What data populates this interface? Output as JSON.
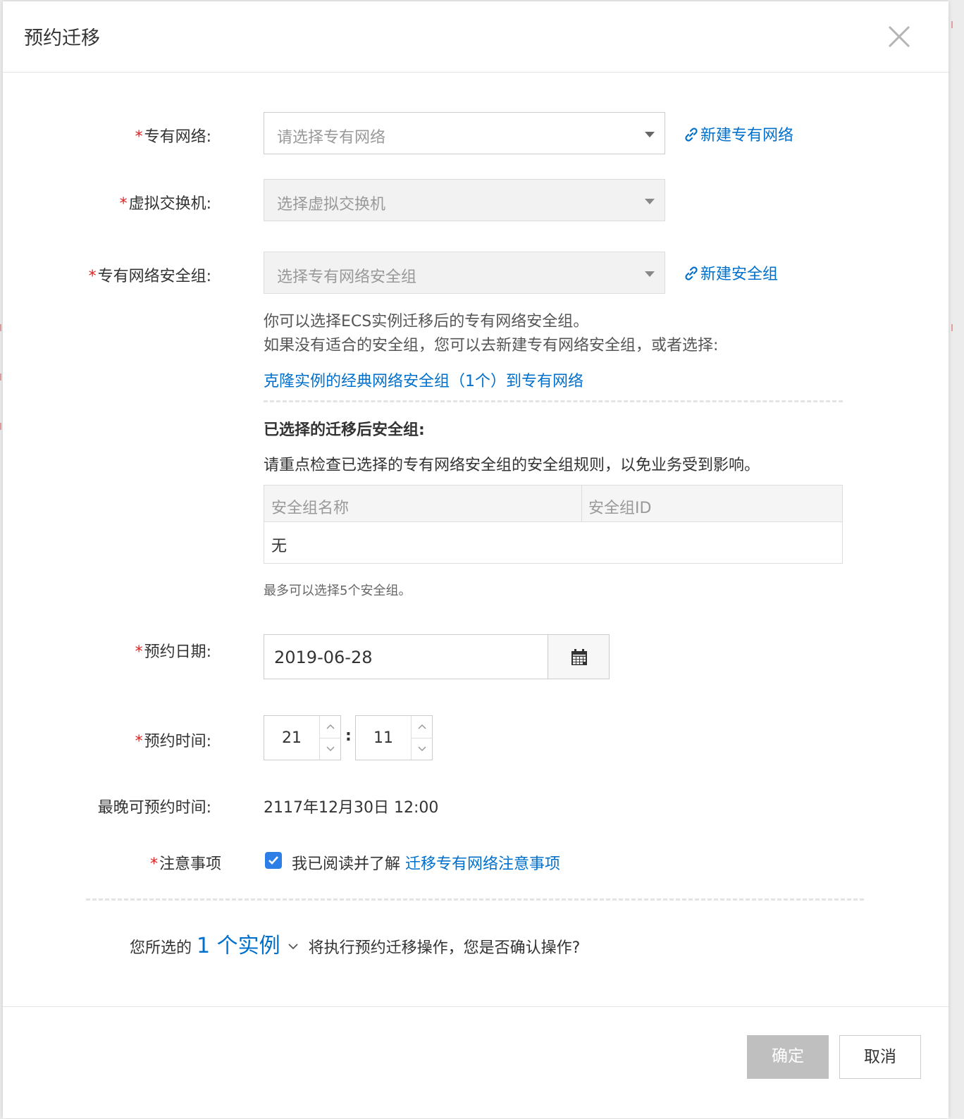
{
  "dialog": {
    "title": "预约迁移",
    "close_icon": "close-icon"
  },
  "vpc": {
    "required": "*",
    "label": "专有网络:",
    "placeholder": "请选择专有网络",
    "create_link": "新建专有网络"
  },
  "vswitch": {
    "required": "*",
    "label": "虚拟交换机:",
    "placeholder": "选择虚拟交换机"
  },
  "security_group": {
    "required": "*",
    "label": "专有网络安全组:",
    "placeholder": "选择专有网络安全组",
    "create_link": "新建安全组",
    "help_line1": "你可以选择ECS实例迁移后的专有网络安全组。",
    "help_line2": "如果没有适合的安全组，您可以去新建专有网络安全组，或者选择:",
    "clone_link": "克隆实例的经典网络安全组（1个）到专有网络",
    "selected_title": "已选择的迁移后安全组:",
    "selected_notice": "请重点检查已选择的专有网络安全组的安全组规则，以免业务受到影响。",
    "table": {
      "columns": [
        "安全组名称",
        "安全组ID"
      ],
      "empty_text": "无"
    },
    "limit_note": "最多可以选择5个安全组。"
  },
  "date": {
    "required": "*",
    "label": "预约日期:",
    "value": "2019-06-28",
    "calendar_icon": "calendar-icon"
  },
  "time": {
    "required": "*",
    "label": "预约时间:",
    "hour": "21",
    "minute": "11",
    "separator": ":"
  },
  "latest": {
    "label": "最晚可预约时间:",
    "value": "2117年12月30日 12:00"
  },
  "notice": {
    "required": "*",
    "label": "注意事项",
    "checked": true,
    "agree_text": "我已阅读并了解",
    "agree_link": "迁移专有网络注意事项"
  },
  "confirm": {
    "prefix": "您所选的",
    "count_text": "1 个实例",
    "suffix": "将执行预约迁移操作，您是否确认操作?"
  },
  "footer": {
    "ok_label": "确定",
    "cancel_label": "取消"
  },
  "colors": {
    "link": "#0070cc",
    "required": "#e02020",
    "checkbox": "#2e7ee8",
    "disabled_button": "#bfbfbf"
  }
}
